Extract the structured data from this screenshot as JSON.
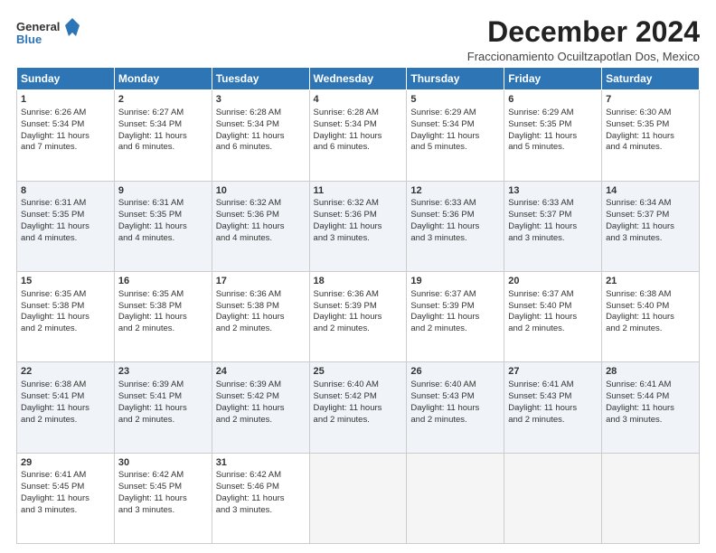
{
  "logo": {
    "line1": "General",
    "line2": "Blue"
  },
  "title": "December 2024",
  "location": "Fraccionamiento Ocuiltzapotlan Dos, Mexico",
  "days_header": [
    "Sunday",
    "Monday",
    "Tuesday",
    "Wednesday",
    "Thursday",
    "Friday",
    "Saturday"
  ],
  "weeks": [
    [
      {
        "day": 1,
        "lines": [
          "Sunrise: 6:26 AM",
          "Sunset: 5:34 PM",
          "Daylight: 11 hours",
          "and 7 minutes."
        ]
      },
      {
        "day": 2,
        "lines": [
          "Sunrise: 6:27 AM",
          "Sunset: 5:34 PM",
          "Daylight: 11 hours",
          "and 6 minutes."
        ]
      },
      {
        "day": 3,
        "lines": [
          "Sunrise: 6:28 AM",
          "Sunset: 5:34 PM",
          "Daylight: 11 hours",
          "and 6 minutes."
        ]
      },
      {
        "day": 4,
        "lines": [
          "Sunrise: 6:28 AM",
          "Sunset: 5:34 PM",
          "Daylight: 11 hours",
          "and 6 minutes."
        ]
      },
      {
        "day": 5,
        "lines": [
          "Sunrise: 6:29 AM",
          "Sunset: 5:34 PM",
          "Daylight: 11 hours",
          "and 5 minutes."
        ]
      },
      {
        "day": 6,
        "lines": [
          "Sunrise: 6:29 AM",
          "Sunset: 5:35 PM",
          "Daylight: 11 hours",
          "and 5 minutes."
        ]
      },
      {
        "day": 7,
        "lines": [
          "Sunrise: 6:30 AM",
          "Sunset: 5:35 PM",
          "Daylight: 11 hours",
          "and 4 minutes."
        ]
      }
    ],
    [
      {
        "day": 8,
        "lines": [
          "Sunrise: 6:31 AM",
          "Sunset: 5:35 PM",
          "Daylight: 11 hours",
          "and 4 minutes."
        ]
      },
      {
        "day": 9,
        "lines": [
          "Sunrise: 6:31 AM",
          "Sunset: 5:35 PM",
          "Daylight: 11 hours",
          "and 4 minutes."
        ]
      },
      {
        "day": 10,
        "lines": [
          "Sunrise: 6:32 AM",
          "Sunset: 5:36 PM",
          "Daylight: 11 hours",
          "and 4 minutes."
        ]
      },
      {
        "day": 11,
        "lines": [
          "Sunrise: 6:32 AM",
          "Sunset: 5:36 PM",
          "Daylight: 11 hours",
          "and 3 minutes."
        ]
      },
      {
        "day": 12,
        "lines": [
          "Sunrise: 6:33 AM",
          "Sunset: 5:36 PM",
          "Daylight: 11 hours",
          "and 3 minutes."
        ]
      },
      {
        "day": 13,
        "lines": [
          "Sunrise: 6:33 AM",
          "Sunset: 5:37 PM",
          "Daylight: 11 hours",
          "and 3 minutes."
        ]
      },
      {
        "day": 14,
        "lines": [
          "Sunrise: 6:34 AM",
          "Sunset: 5:37 PM",
          "Daylight: 11 hours",
          "and 3 minutes."
        ]
      }
    ],
    [
      {
        "day": 15,
        "lines": [
          "Sunrise: 6:35 AM",
          "Sunset: 5:38 PM",
          "Daylight: 11 hours",
          "and 2 minutes."
        ]
      },
      {
        "day": 16,
        "lines": [
          "Sunrise: 6:35 AM",
          "Sunset: 5:38 PM",
          "Daylight: 11 hours",
          "and 2 minutes."
        ]
      },
      {
        "day": 17,
        "lines": [
          "Sunrise: 6:36 AM",
          "Sunset: 5:38 PM",
          "Daylight: 11 hours",
          "and 2 minutes."
        ]
      },
      {
        "day": 18,
        "lines": [
          "Sunrise: 6:36 AM",
          "Sunset: 5:39 PM",
          "Daylight: 11 hours",
          "and 2 minutes."
        ]
      },
      {
        "day": 19,
        "lines": [
          "Sunrise: 6:37 AM",
          "Sunset: 5:39 PM",
          "Daylight: 11 hours",
          "and 2 minutes."
        ]
      },
      {
        "day": 20,
        "lines": [
          "Sunrise: 6:37 AM",
          "Sunset: 5:40 PM",
          "Daylight: 11 hours",
          "and 2 minutes."
        ]
      },
      {
        "day": 21,
        "lines": [
          "Sunrise: 6:38 AM",
          "Sunset: 5:40 PM",
          "Daylight: 11 hours",
          "and 2 minutes."
        ]
      }
    ],
    [
      {
        "day": 22,
        "lines": [
          "Sunrise: 6:38 AM",
          "Sunset: 5:41 PM",
          "Daylight: 11 hours",
          "and 2 minutes."
        ]
      },
      {
        "day": 23,
        "lines": [
          "Sunrise: 6:39 AM",
          "Sunset: 5:41 PM",
          "Daylight: 11 hours",
          "and 2 minutes."
        ]
      },
      {
        "day": 24,
        "lines": [
          "Sunrise: 6:39 AM",
          "Sunset: 5:42 PM",
          "Daylight: 11 hours",
          "and 2 minutes."
        ]
      },
      {
        "day": 25,
        "lines": [
          "Sunrise: 6:40 AM",
          "Sunset: 5:42 PM",
          "Daylight: 11 hours",
          "and 2 minutes."
        ]
      },
      {
        "day": 26,
        "lines": [
          "Sunrise: 6:40 AM",
          "Sunset: 5:43 PM",
          "Daylight: 11 hours",
          "and 2 minutes."
        ]
      },
      {
        "day": 27,
        "lines": [
          "Sunrise: 6:41 AM",
          "Sunset: 5:43 PM",
          "Daylight: 11 hours",
          "and 2 minutes."
        ]
      },
      {
        "day": 28,
        "lines": [
          "Sunrise: 6:41 AM",
          "Sunset: 5:44 PM",
          "Daylight: 11 hours",
          "and 3 minutes."
        ]
      }
    ],
    [
      {
        "day": 29,
        "lines": [
          "Sunrise: 6:41 AM",
          "Sunset: 5:45 PM",
          "Daylight: 11 hours",
          "and 3 minutes."
        ]
      },
      {
        "day": 30,
        "lines": [
          "Sunrise: 6:42 AM",
          "Sunset: 5:45 PM",
          "Daylight: 11 hours",
          "and 3 minutes."
        ]
      },
      {
        "day": 31,
        "lines": [
          "Sunrise: 6:42 AM",
          "Sunset: 5:46 PM",
          "Daylight: 11 hours",
          "and 3 minutes."
        ]
      },
      null,
      null,
      null,
      null
    ]
  ]
}
